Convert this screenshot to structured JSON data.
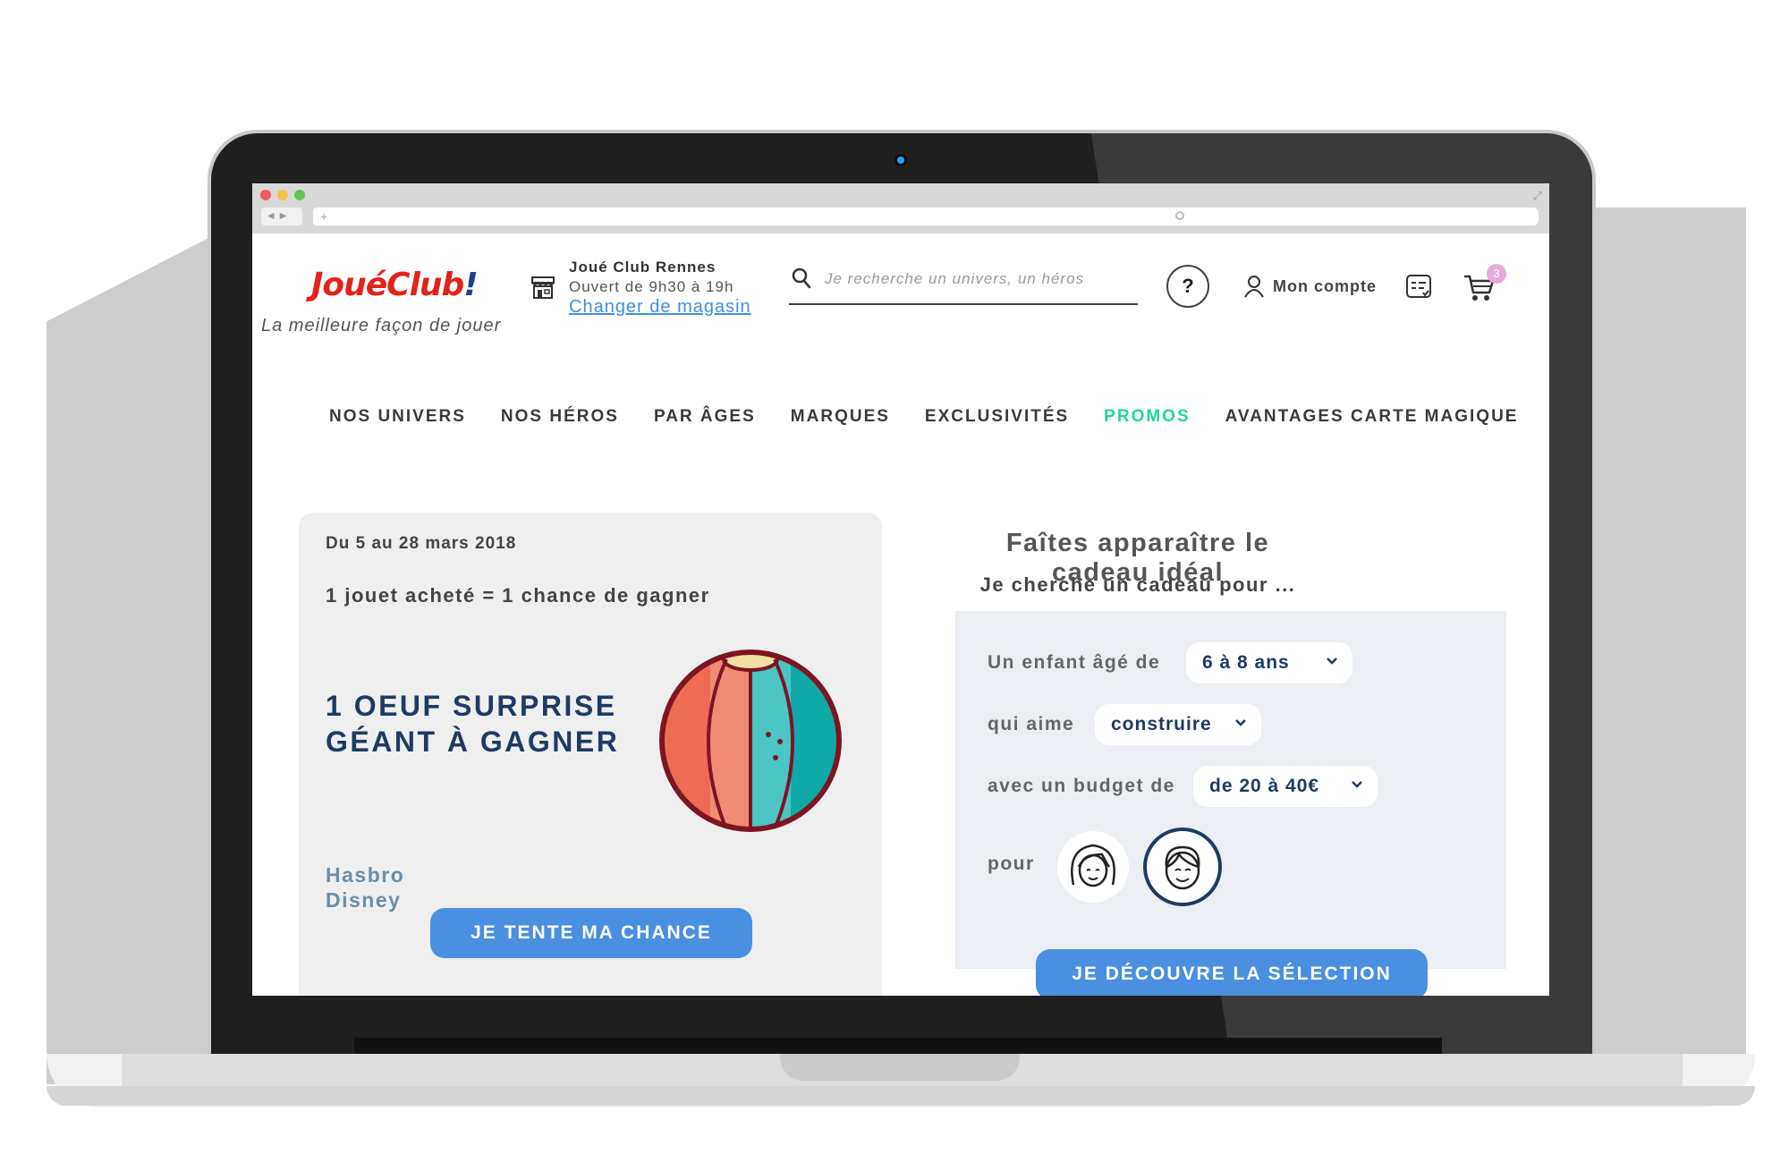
{
  "browser": {
    "url_placeholder": "+"
  },
  "header": {
    "logo_text": "JouéClub",
    "logo_bang": "!",
    "tagline": "La meilleure façon de jouer",
    "store_name": "Joué Club Rennes",
    "store_hours": "Ouvert de 9h30 à 19h",
    "store_change": "Changer de magasin",
    "search_placeholder": "Je recherche un univers, un héros",
    "help": "?",
    "account": "Mon compte",
    "cart_count": "3"
  },
  "menu": [
    {
      "label": "NOS UNIVERS"
    },
    {
      "label": "NOS HÉROS"
    },
    {
      "label": "PAR ÂGES"
    },
    {
      "label": "MARQUES"
    },
    {
      "label": "EXCLUSIVITÉS"
    },
    {
      "label": "PROMOS"
    },
    {
      "label": "AVANTAGES CARTE MAGIQUE"
    }
  ],
  "promo": {
    "dates": "Du 5 au 28 mars 2018",
    "rule": "1 jouet acheté = 1 chance de gagner",
    "title": "1 OEUF SURPRISE GÉANT À GAGNER",
    "brands": [
      "Hasbro",
      "Disney"
    ],
    "cta": "JE TENTE MA CHANCE"
  },
  "gift_finder": {
    "title": "Faîtes apparaître le cadeau idéal",
    "subtitle": "Je cherche un cadeau pour ...",
    "age_label": "Un enfant âgé de",
    "age_value": "6 à 8 ans",
    "likes_label": "qui aime",
    "likes_value": "construire",
    "budget_label": "avec un budget de",
    "budget_value": "de 20 à 40€",
    "for_label": "pour",
    "cta": "JE DÉCOUVRE LA SÉLECTION"
  },
  "colors": {
    "brand_red": "#e2231a",
    "brand_blue": "#1e3d8f",
    "accent_green": "#1ed6a0",
    "button_blue": "#4a8fe0",
    "navy": "#1f3a63"
  }
}
